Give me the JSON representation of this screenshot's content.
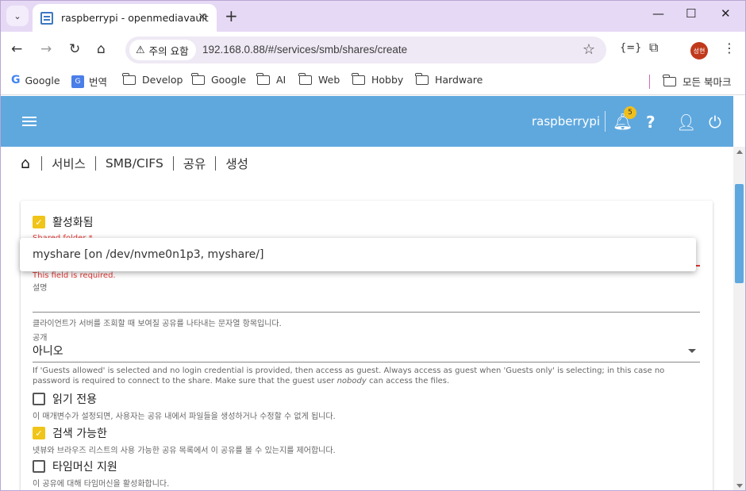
{
  "browser": {
    "tab_title": "raspberrypi - openmediavault",
    "security_label": "주의 요함",
    "url": "192.168.0.88/#/services/smb/shares/create",
    "profile_initials": "성현",
    "bookmarks": [
      "Google",
      "번역",
      "Develop",
      "Google",
      "AI",
      "Web",
      "Hobby",
      "Hardware"
    ],
    "all_bookmarks": "모든 북마크"
  },
  "header": {
    "hostname": "raspberrypi",
    "notification_count": "5",
    "color": "#5fa8de"
  },
  "breadcrumb": [
    "서비스",
    "SMB/CIFS",
    "공유",
    "생성"
  ],
  "form": {
    "enabled": {
      "label": "활성화됨",
      "checked": true
    },
    "shared_folder": {
      "label": "Shared folder *",
      "error": "This field is required.",
      "option": "myshare [on /dev/nvme0n1p3, myshare/]"
    },
    "comment": {
      "label": "설명",
      "hint": "클라이언트가 서버를 조회할 때 보여질 공유를 나타내는 문자열 항목입니다."
    },
    "public": {
      "label": "공개",
      "value": "아니오",
      "hint_part1": "If 'Guests allowed' is selected and no login credential is provided, then access as guest. Always access as guest when 'Guests only' is selecting; in this case no password is required to connect to the share. Make sure that the guest user",
      "hint_em": "nobody",
      "hint_part2": "can access the files."
    },
    "read_only": {
      "label": "읽기 전용",
      "checked": false,
      "hint": "이 매개변수가 설정되면, 사용자는 공유 내에서 파일들을 생성하거나 수정할 수 없게 됩니다."
    },
    "browseable": {
      "label": "검색 가능한",
      "checked": true,
      "hint": "넷뷰와 브라우즈 리스트의 사용 가능한 공유 목록에서 이 공유를 볼 수 있는지를 제어합니다."
    },
    "time_machine": {
      "label": "타임머신 지원",
      "checked": false,
      "hint": "이 공유에 대해 타임머신을 활성화합니다."
    }
  }
}
